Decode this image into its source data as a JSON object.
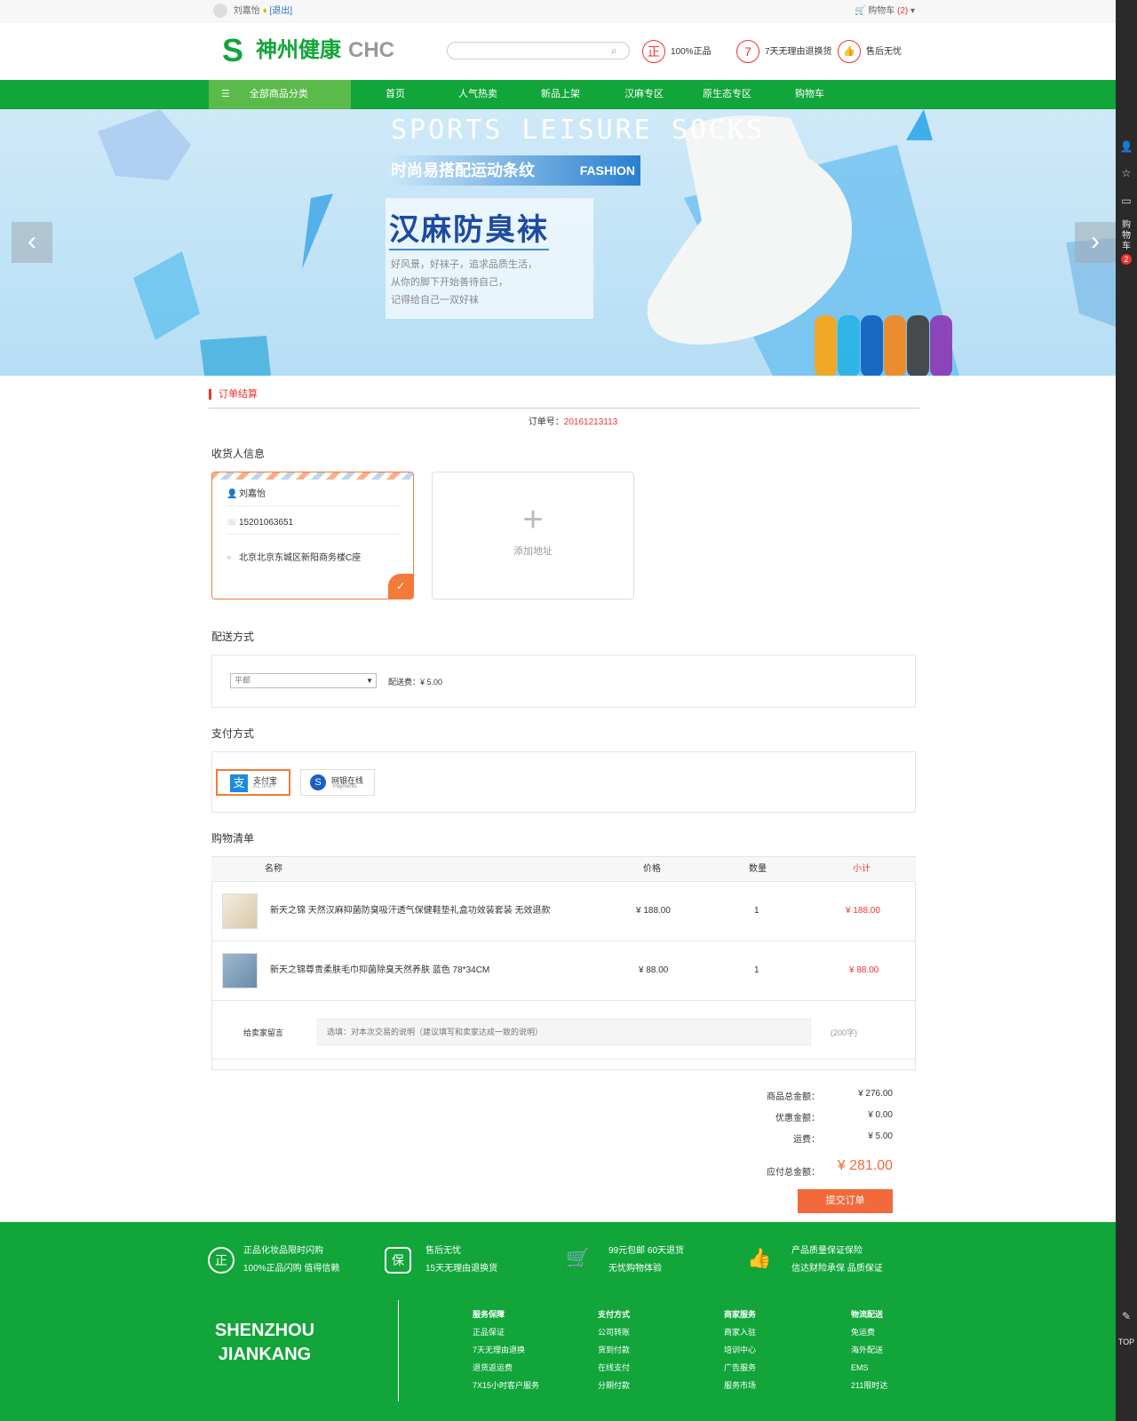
{
  "topbar": {
    "username": "刘嘉怡",
    "logout": "[退出]",
    "cart_label": "购物车",
    "cart_count": "(2)"
  },
  "header": {
    "logo_cn": "神州健康",
    "logo_en": "CHC",
    "search_placeholder": "",
    "promises": [
      {
        "badge": "正",
        "text": "100%正品"
      },
      {
        "badge": "7",
        "text": "7天无理由退换货"
      },
      {
        "badge": "👍",
        "text": "售后无忧"
      }
    ]
  },
  "nav": {
    "all_categories": "全部商品分类",
    "items": [
      "首页",
      "人气热卖",
      "新品上架",
      "汉麻专区",
      "原生态专区",
      "购物车"
    ]
  },
  "banner": {
    "line1": "SPORTS LEISURE SOCKS",
    "line2": "时尚易搭配运动条纹",
    "line2_en": "FASHION",
    "headline": "汉麻防臭袜",
    "desc": [
      "好风景，好袜子，追求品质生活，",
      "从你的脚下开始善待自己，",
      "记得给自己一双好袜"
    ]
  },
  "rail": {
    "cart_vertical": [
      "购",
      "物",
      "车"
    ],
    "cart_badge": "2",
    "top": "TOP"
  },
  "order": {
    "section_title": "订单结算",
    "order_no_label": "订单号：",
    "order_no": "20161213113"
  },
  "receiver": {
    "title": "收货人信息",
    "name": "刘嘉怡",
    "phone": "15201063651",
    "address": "北京北京东城区新阳商务楼C座",
    "add_label": "添加地址"
  },
  "delivery": {
    "title": "配送方式",
    "selected": "平邮",
    "fee_label": "配送费：",
    "fee": "¥ 5.00"
  },
  "payment": {
    "title": "支付方式",
    "options": [
      {
        "name": "支付宝",
        "sub": "ALIPAY",
        "selected": true
      },
      {
        "name": "网银在线",
        "sub": "Payments",
        "selected": false
      }
    ]
  },
  "cart": {
    "title": "购物清单",
    "headers": {
      "name": "名称",
      "price": "价格",
      "qty": "数量",
      "subtotal": "小计"
    },
    "rows": [
      {
        "name": "新天之锦 天然汉麻抑菌防臭吸汗透气保健鞋垫礼盒功效装套装 无效退款",
        "price": "¥ 188.00",
        "qty": "1",
        "subtotal": "¥ 188.00"
      },
      {
        "name": "新天之锦尊贵柔肤毛巾抑菌除臭天然养肤 蓝色 78*34CM",
        "price": "¥ 88.00",
        "qty": "1",
        "subtotal": "¥ 88.00"
      }
    ],
    "message_label": "给卖家留言",
    "message_placeholder": "选填：对本次交易的说明（建议填写和卖家达成一致的说明）",
    "message_limit": "(200字)"
  },
  "summary": {
    "goods_label": "商品总金额：",
    "goods": "¥ 276.00",
    "discount_label": "优惠金额：",
    "discount": "¥ 0.00",
    "shipping_label": "运费：",
    "shipping": "¥ 5.00",
    "total_label": "应付总金额：",
    "total": "¥ 281.00",
    "submit": "提交订单"
  },
  "footer": {
    "features": [
      {
        "icon": "正",
        "l1": "正品化妆品限时闪购",
        "l2": "100%正品闪购 值得信赖"
      },
      {
        "icon": "保",
        "l1": "售后无忧",
        "l2": "15天无理由退换货"
      },
      {
        "icon": "🛒",
        "l1": "99元包邮 60天退货",
        "l2": "无忧购物体验"
      },
      {
        "icon": "👍",
        "l1": "产品质量保证保险",
        "l2": "信达财险承保 品质保证"
      }
    ],
    "brand": [
      "SHENZHOU",
      "JIANKANG"
    ],
    "columns": [
      {
        "title": "服务保障",
        "items": [
          "正品保证",
          "7天无理由退换",
          "退货返运费",
          "7X15小时客户服务"
        ]
      },
      {
        "title": "支付方式",
        "items": [
          "公司转账",
          "货到付款",
          "在线支付",
          "分期付款"
        ]
      },
      {
        "title": "商家服务",
        "items": [
          "商家入驻",
          "培训中心",
          "广告服务",
          "服务市场"
        ]
      },
      {
        "title": "物流配送",
        "items": [
          "免运费",
          "海外配送",
          "EMS",
          "211限时达"
        ]
      }
    ]
  },
  "colors": {
    "brand_green": "#11a53a",
    "accent_orange": "#f26a3b",
    "price_red": "#e33333"
  }
}
